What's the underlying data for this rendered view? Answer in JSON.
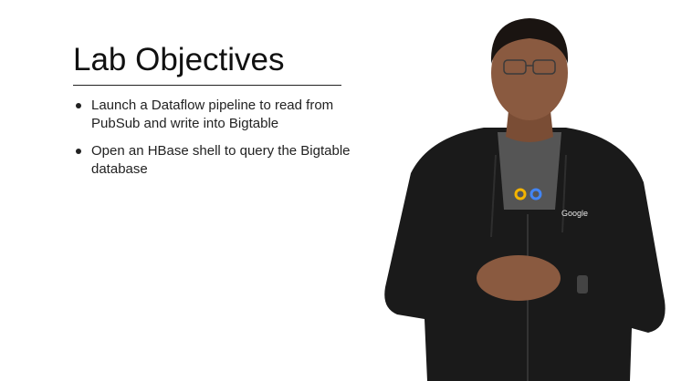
{
  "slide": {
    "title": "Lab Objectives",
    "objectives": [
      "Launch a Dataflow pipeline to read from PubSub and write into Bigtable",
      "Open an HBase shell to query the Bigtable database"
    ]
  },
  "presenter": {
    "shirt_logo": "Google"
  },
  "colors": {
    "background": "#ffffff",
    "text": "#222222",
    "hoodie": "#1a1a1a",
    "tshirt": "#555555",
    "skin": "#8a5a40"
  }
}
